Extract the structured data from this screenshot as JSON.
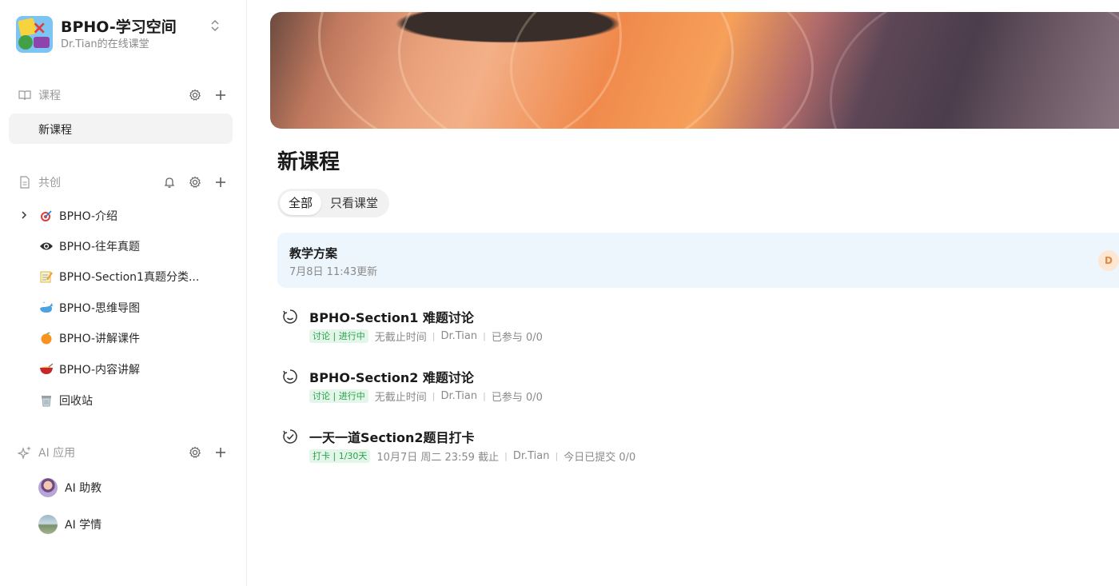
{
  "workspace": {
    "title": "BPHO-学习空间",
    "subtitle": "Dr.Tian的在线课堂",
    "switch_icon": "chevron-updown-icon"
  },
  "sidebar": {
    "courses": {
      "label": "课程",
      "icon": "book-icon",
      "items": [
        {
          "label": "新课程",
          "active": true
        }
      ]
    },
    "cocreate": {
      "label": "共创",
      "icon": "document-icon",
      "items": [
        {
          "label": "BPHO-介绍",
          "icon": "dart-target-icon",
          "expandable": true
        },
        {
          "label": "BPHO-往年真题",
          "icon": "eye-icon"
        },
        {
          "label": "BPHO-Section1真题分类...",
          "icon": "memo-icon"
        },
        {
          "label": "BPHO-思维导图",
          "icon": "whale-icon"
        },
        {
          "label": "BPHO-讲解课件",
          "icon": "orange-icon"
        },
        {
          "label": "BPHO-内容讲解",
          "icon": "bowl-icon"
        },
        {
          "label": "回收站",
          "icon": "trash-icon"
        }
      ]
    },
    "ai": {
      "label": "AI 应用",
      "icon": "sparkle-icon",
      "items": [
        {
          "label": "AI 助教",
          "icon": "avatar-icon"
        },
        {
          "label": "AI 学情",
          "icon": "avatar-icon"
        }
      ]
    }
  },
  "main": {
    "title": "新课程",
    "filters": [
      {
        "label": "全部",
        "active": true
      },
      {
        "label": "只看课堂",
        "active": false
      }
    ],
    "doc_card": {
      "title": "教学方案",
      "updated": "7月8日 11:43更新",
      "badge": "D"
    },
    "activities": [
      {
        "title": "BPHO-Section1 难题讨论",
        "icon": "discussion-timer-icon",
        "tag": "讨论 | 进行中",
        "meta": [
          "无截止时间",
          "Dr.Tian",
          "已参与 0/0"
        ]
      },
      {
        "title": "BPHO-Section2 难题讨论",
        "icon": "discussion-timer-icon",
        "tag": "讨论 | 进行中",
        "meta": [
          "无截止时间",
          "Dr.Tian",
          "已参与 0/0"
        ]
      },
      {
        "title": "一天一道Section2题目打卡",
        "icon": "checkin-icon",
        "tag": "打卡 | 1/30天",
        "meta": [
          "10月7日 周二 23:59 截止",
          "Dr.Tian",
          "今日已提交 0/0"
        ]
      }
    ],
    "separator": "|"
  }
}
